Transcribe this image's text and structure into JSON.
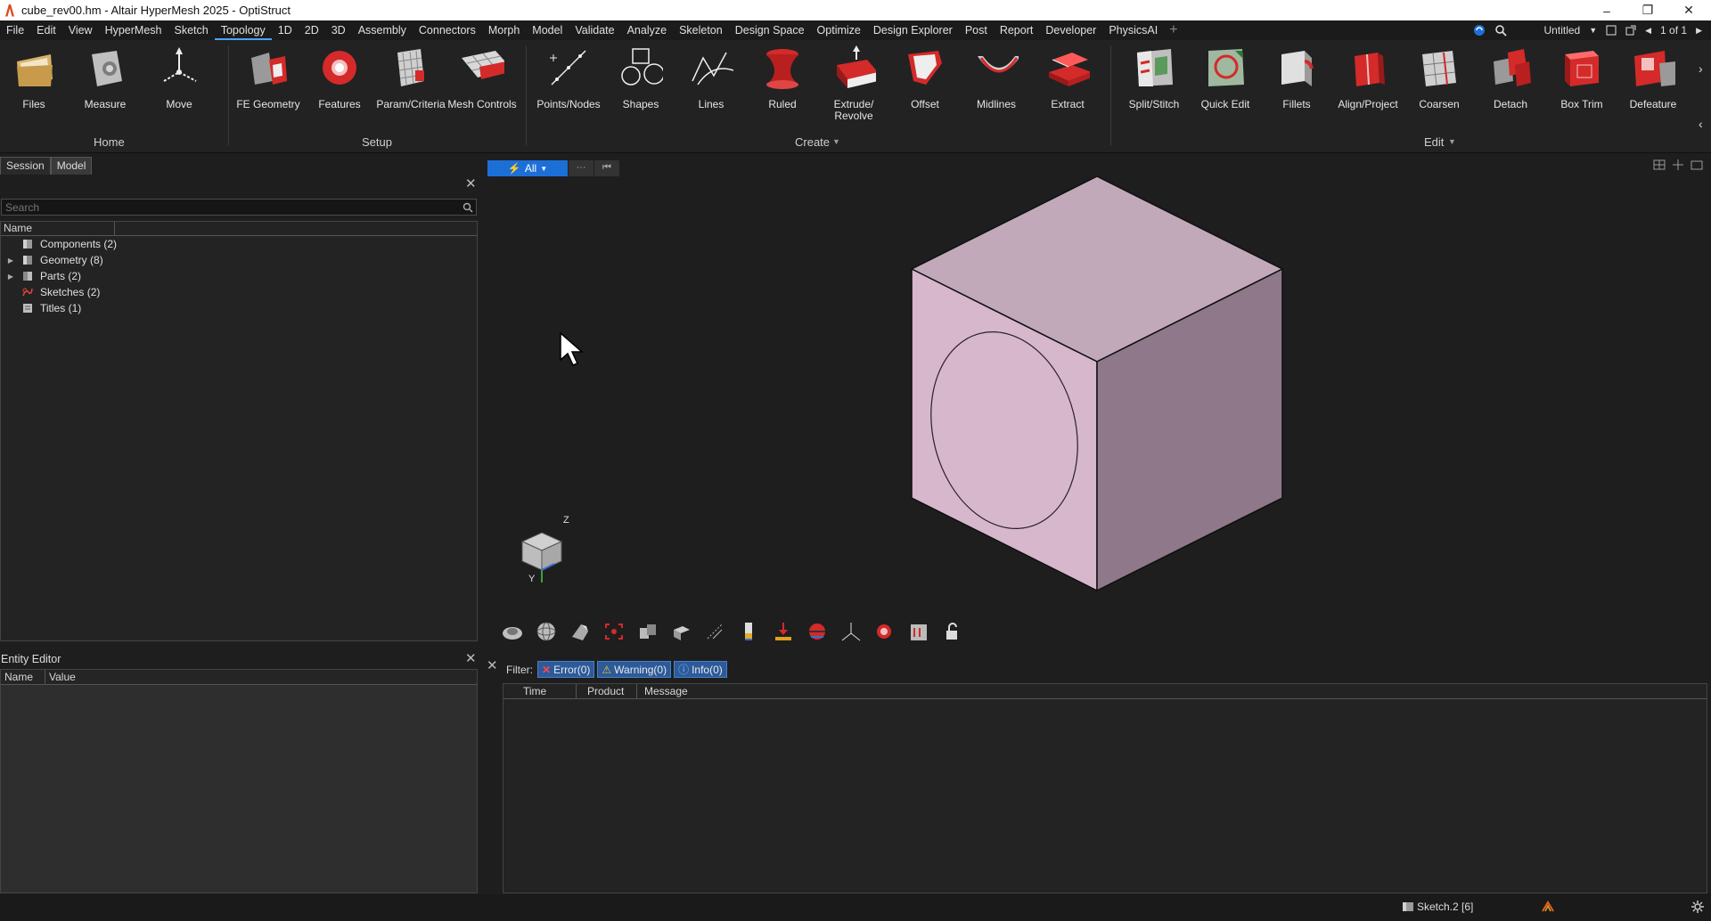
{
  "window": {
    "title": "cube_rev00.hm - Altair HyperMesh 2025 - OptiStruct",
    "controls": [
      "–",
      "❐",
      "✕"
    ]
  },
  "menu": {
    "items": [
      "File",
      "Edit",
      "View",
      "HyperMesh",
      "Sketch",
      "Topology",
      "1D",
      "2D",
      "3D",
      "Assembly",
      "Connectors",
      "Morph",
      "Model",
      "Validate",
      "Analyze",
      "Skeleton",
      "Design Space",
      "Optimize",
      "Design Explorer",
      "Post",
      "Report",
      "Developer",
      "PhysicsAI"
    ],
    "active": "Topology",
    "plus": "+",
    "session_name": "Untitled",
    "page_indicator": "1 of 1"
  },
  "ribbon": {
    "groups": [
      "Home",
      "Setup",
      "Create",
      "Edit"
    ],
    "tools": [
      "Files",
      "Measure",
      "Move",
      "FE Geometry",
      "Features",
      "Param/Criteria",
      "Mesh Controls",
      "Points/Nodes",
      "Shapes",
      "Lines",
      "Ruled",
      "Extrude/\nRevolve",
      "Offset",
      "Midlines",
      "Extract",
      "Split/Stitch",
      "Quick Edit",
      "Fillets",
      "Align/Project",
      "Coarsen",
      "Detach",
      "Box Trim",
      "Defeature"
    ]
  },
  "left_panel": {
    "tabs": [
      "Session",
      "Model"
    ],
    "active_tab": "Model",
    "search_placeholder": "Search",
    "column_name": "Name",
    "tree": [
      {
        "label": "Components",
        "count": "(2)",
        "expandable": false,
        "icon": "component-icon"
      },
      {
        "label": "Geometry",
        "count": "(8)",
        "expandable": true,
        "icon": "geometry-icon"
      },
      {
        "label": "Parts",
        "count": "(2)",
        "expandable": true,
        "icon": "parts-icon"
      },
      {
        "label": "Sketches",
        "count": "(2)",
        "expandable": false,
        "icon": "sketch-icon"
      },
      {
        "label": "Titles",
        "count": "(1)",
        "expandable": false,
        "icon": "titles-icon"
      }
    ]
  },
  "entity_editor": {
    "title": "Entity Editor",
    "columns": [
      "Name",
      "Value"
    ]
  },
  "viewport": {
    "selection_filter": "All",
    "filter_more": "···",
    "filter_last": "⏮",
    "triad_axis_z": "Z",
    "triad_axis_y": "Y",
    "cube_colors": {
      "top": "#c1a9ba",
      "left": "#d6b7cc",
      "right": "#8f7889"
    }
  },
  "messages": {
    "filter_label": "Filter:",
    "error": "Error(0)",
    "warning": "Warning(0)",
    "info": "Info(0)",
    "columns": [
      "Time",
      "Product",
      "Message"
    ]
  },
  "status": {
    "active_sketch": "Sketch.2 [6]"
  },
  "colors": {
    "accent": "#1d6fd8",
    "background": "#1e1e1e",
    "ribbon_red": "#d42a2a"
  }
}
